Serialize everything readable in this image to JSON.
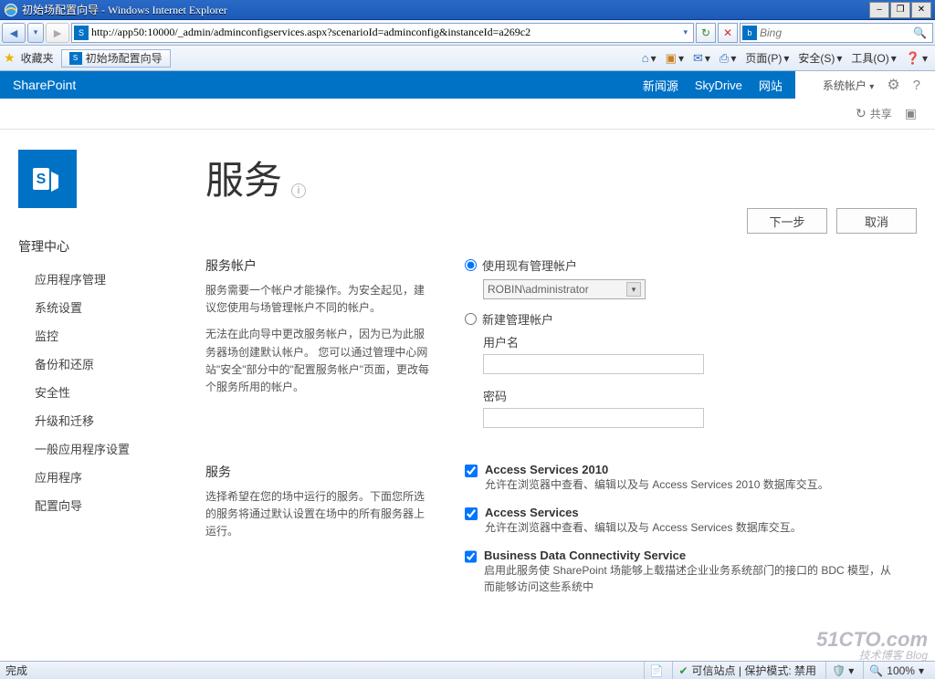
{
  "window": {
    "title": "初始场配置向导 - Windows Internet Explorer",
    "min": "–",
    "max": "❐",
    "close": "✕"
  },
  "address_bar": {
    "url": "http://app50:10000/_admin/adminconfigservices.aspx?scenarioId=adminconfig&instanceId=a269c2",
    "search_placeholder": "Bing"
  },
  "favorites": {
    "label": "收藏夹",
    "tab_title": "初始场配置向导"
  },
  "command_bar": {
    "page": "页面(P)",
    "safety": "安全(S)",
    "tools": "工具(O)"
  },
  "suite": {
    "brand": "SharePoint",
    "links": [
      "新闻源",
      "SkyDrive",
      "网站"
    ],
    "account": "系统帐户",
    "share": "共享"
  },
  "sidebar": {
    "heading": "管理中心",
    "items": [
      "应用程序管理",
      "系统设置",
      "监控",
      "备份和还原",
      "安全性",
      "升级和迁移",
      "一般应用程序设置",
      "应用程序",
      "配置向导"
    ]
  },
  "page_title": "服务",
  "buttons": {
    "next": "下一步",
    "cancel": "取消"
  },
  "account_section": {
    "title": "服务帐户",
    "desc1": "服务需要一个帐户才能操作。为安全起见，建议您使用与场管理帐户不同的帐户。",
    "desc2": "无法在此向导中更改服务帐户，因为已为此服务器场创建默认帐户。 您可以通过管理中心网站\"安全\"部分中的\"配置服务帐户\"页面，更改每个服务所用的帐户。",
    "radio_existing": "使用现有管理帐户",
    "select_value": "ROBIN\\administrator",
    "radio_new": "新建管理帐户",
    "username_label": "用户名",
    "password_label": "密码"
  },
  "services_section": {
    "title": "服务",
    "desc": "选择希望在您的场中运行的服务。下面您所选的服务将通过默认设置在场中的所有服务器上运行。",
    "items": [
      {
        "title": "Access Services 2010",
        "desc": "允许在浏览器中查看、编辑以及与 Access Services 2010 数据库交互。"
      },
      {
        "title": "Access Services",
        "desc": "允许在浏览器中查看、编辑以及与 Access Services 数据库交互。"
      },
      {
        "title": "Business Data Connectivity Service",
        "desc": "启用此服务使 SharePoint 场能够上载描述企业业务系统部门的接口的 BDC 模型，从而能够访问这些系统中"
      }
    ]
  },
  "statusbar": {
    "done": "完成",
    "trusted": "可信站点 | 保护模式: 禁用",
    "zoom": "100%"
  },
  "watermark": {
    "line1": "51CTO.com",
    "line2": "技术博客  Blog"
  }
}
